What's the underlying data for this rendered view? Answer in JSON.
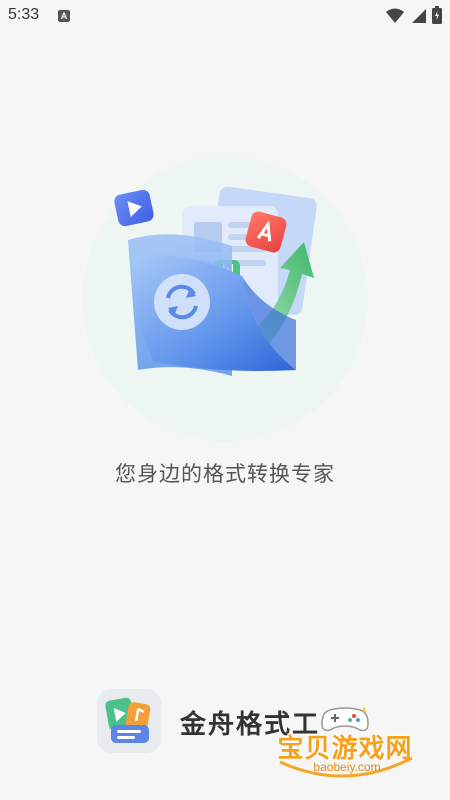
{
  "status_bar": {
    "time": "5:33",
    "notification_icon": "a-letter-icon",
    "icons": [
      "wifi-icon",
      "signal-icon",
      "battery-icon"
    ]
  },
  "hero": {
    "illustration": "file-conversion-folder-illustration",
    "accent_colors": {
      "folder_blue": "#4d86ea",
      "arrow_green": "#4fbf7a",
      "badge_red": "#f0524a",
      "play_blue": "#4f6ff0"
    }
  },
  "tagline": "您身边的格式转换专家",
  "brand": {
    "name": "金舟格式工",
    "logo": "app-logo-icon"
  },
  "watermark": {
    "text": "宝贝游戏网",
    "url": "baobeiy.com",
    "color": "#f5a11d"
  }
}
